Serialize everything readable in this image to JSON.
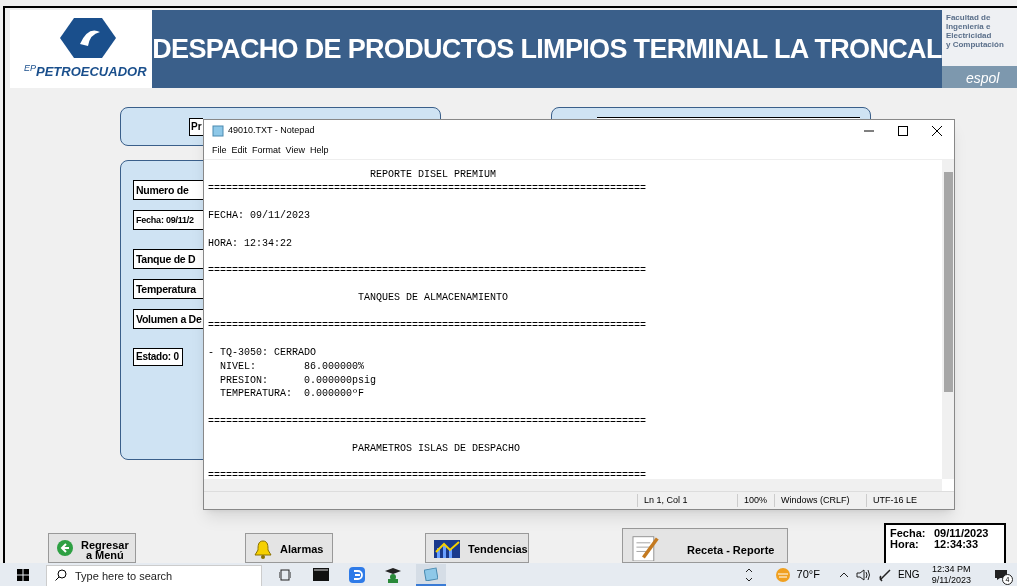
{
  "header": {
    "company_logo": "PETROECUADOR",
    "company_prefix": "EP",
    "title": "DESPACHO DE PRODUCTOS LIMPIOS TERMINAL LA TRONCAL",
    "faculty_lines": [
      "Facultad de Ingeniería e",
      "Electricidad",
      "y Computación"
    ],
    "university": "espol"
  },
  "top_fields": [
    "Pr"
  ],
  "form_fields": [
    "Numero de",
    "Fecha:  09/11/2",
    "Tanque de D",
    "Temperatura",
    "Volumen a De",
    "Estado: 0"
  ],
  "bottom_buttons": [
    {
      "kind": "back",
      "label": "Regresar a Menú"
    },
    {
      "kind": "bell",
      "label": "Alarmas"
    },
    {
      "kind": "chart",
      "label": "Tendencias"
    },
    {
      "kind": "report",
      "label": "Receta - Reporte"
    }
  ],
  "info_box": [
    {
      "label": "Fecha:",
      "value": "09/11/2023"
    },
    {
      "label": "Hora:",
      "value": "12:34:33"
    }
  ],
  "notepad": {
    "title": "49010.TXT - Notepad",
    "menu": [
      "File",
      "Edit",
      "Format",
      "View",
      "Help"
    ],
    "content": "                           REPORTE DISEL PREMIUM\n=========================================================================\n\nFECHA: 09/11/2023\n\nHORA: 12:34:22\n\n=========================================================================\n\n                         TANQUES DE ALMACENAMIENTO\n\n=========================================================================\n\n- TQ-3050: CERRADO\n  NIVEL:        86.000000%\n  PRESION:      0.000000psig\n  TEMPERATURA:  0.000000ºF\n\n=========================================================================\n\n                        PARAMETROS ISLAS DE DESPACHO\n\n=========================================================================",
    "status": [
      "Ln 1, Col 1",
      "100%",
      "Windows (CRLF)",
      "UTF-16 LE"
    ]
  },
  "taskbar": {
    "search_placeholder": "Type here to search",
    "weather": "70°F",
    "language": "ENG",
    "time": "12:34 PM",
    "date": "9/11/2023",
    "notification_count": "4"
  }
}
